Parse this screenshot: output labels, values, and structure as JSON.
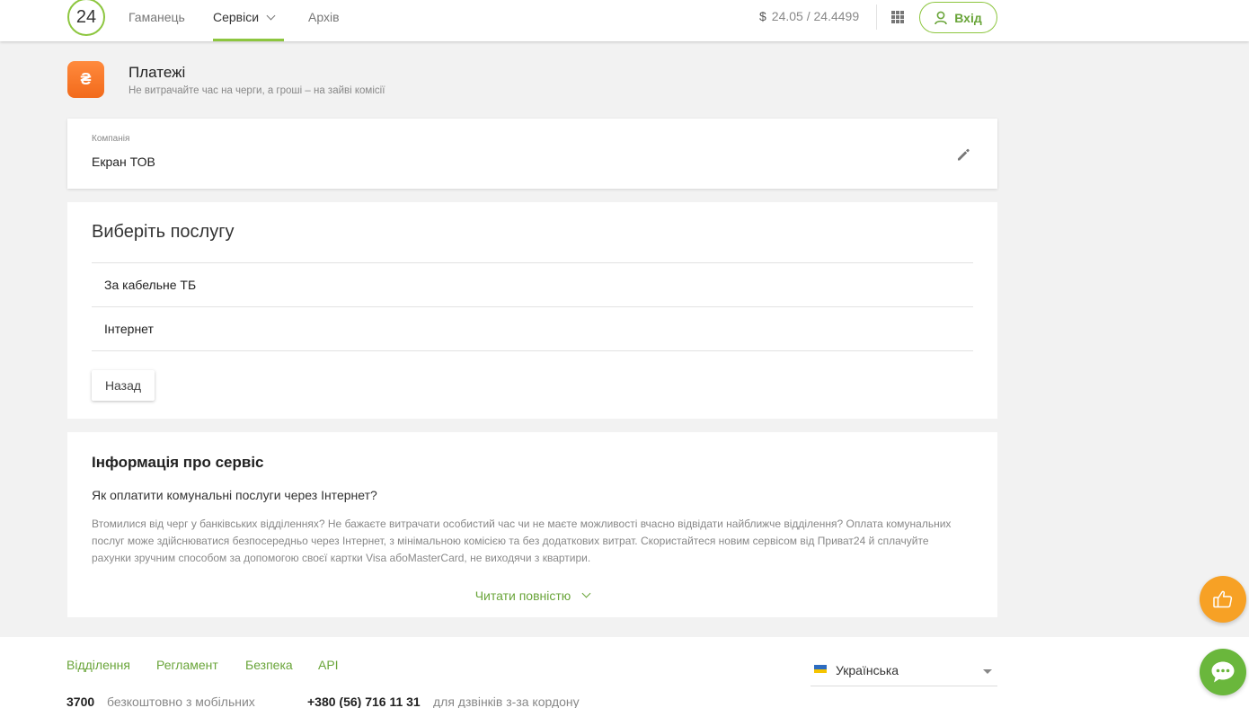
{
  "header": {
    "logo_text": "24",
    "nav": [
      {
        "label": "Гаманець"
      },
      {
        "label": "Сервіси"
      },
      {
        "label": "Архів"
      }
    ],
    "rate_currency": "$",
    "rate_value": "24.05 / 24.4499",
    "login_label": "Вхід"
  },
  "page": {
    "icon_symbol": "₴",
    "title": "Платежі",
    "subtitle": "Не витрачайте час на черги, а гроші – на зайві комісії"
  },
  "company": {
    "label": "Компанія",
    "value": "Екран ТОВ"
  },
  "services": {
    "title": "Виберіть послугу",
    "items": [
      {
        "label": "За кабельне ТБ"
      },
      {
        "label": "Інтернет"
      }
    ],
    "back_label": "Назад"
  },
  "info": {
    "title": "Інформація про сервіс",
    "question": "Як оплатити комунальні послуги через Інтернет?",
    "text": "Втомилися від черг у банківських відділеннях? Не бажаєте витрачати особистий час чи не маєте можливості вчасно відвідати найближче відділення? Оплата комунальних послуг може здійснюватися безпосередньо через Інтернет, з мінімальною комісією та без додаткових витрат. Скористайтеся новим сервісом від Приват24 й сплачуйте рахунки зручним способом за допомогою своєї картки Visa абоMasterCard, не виходячи з квартири.",
    "read_more": "Читати повністю"
  },
  "footer": {
    "links": [
      {
        "label": "Відділення"
      },
      {
        "label": "Регламент"
      },
      {
        "label": "Безпека"
      },
      {
        "label": "API"
      }
    ],
    "phones": [
      {
        "number": "3700",
        "note": "безкоштовно з мобільних"
      },
      {
        "number": "+380 (56) 716 11 31",
        "note": "для дзвінків з-за кордону"
      }
    ],
    "language": "Українська"
  },
  "colors": {
    "accent_green": "#8dc63f",
    "link_green": "#6aa53a",
    "orange": "#f26a1b",
    "like_fab": "#f7a125",
    "chat_fab": "#6ab73c"
  },
  "icons": [
    "logo-24",
    "chevron-down-icon",
    "apps-grid-icon",
    "user-icon",
    "hryvnia-icon",
    "pencil-icon",
    "thumbs-up-icon",
    "chat-bubble-icon",
    "ukraine-flag-icon"
  ]
}
